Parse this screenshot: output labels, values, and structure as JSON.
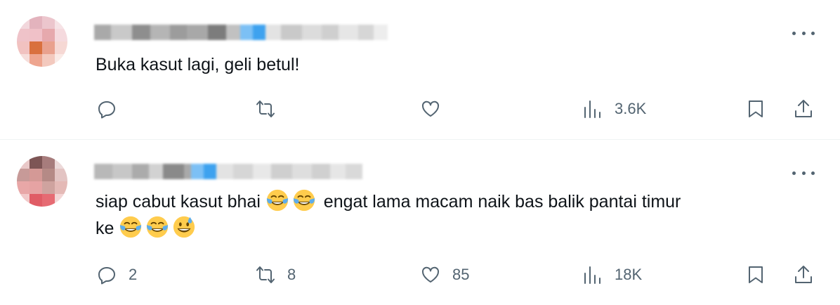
{
  "colors": {
    "text": "#0f1419",
    "muted": "#536471",
    "divider": "#eff3f4",
    "verified": "#1d9bf0"
  },
  "tweets": [
    {
      "text": "Buka kasut lagi, geli betul!",
      "replies": "",
      "retweets": "",
      "likes": "",
      "views": "3.6K"
    },
    {
      "text_parts": [
        "siap cabut kasut bhai",
        "engat lama macam naik bas balik pantai timur",
        "ke"
      ],
      "emojis_line1": [
        "face-with-tears-of-joy",
        "face-with-tears-of-joy"
      ],
      "emojis_line2": [
        "face-with-tears-of-joy",
        "face-with-tears-of-joy",
        "grinning-face-with-sweat"
      ],
      "replies": "2",
      "retweets": "8",
      "likes": "85",
      "views": "18K"
    }
  ]
}
